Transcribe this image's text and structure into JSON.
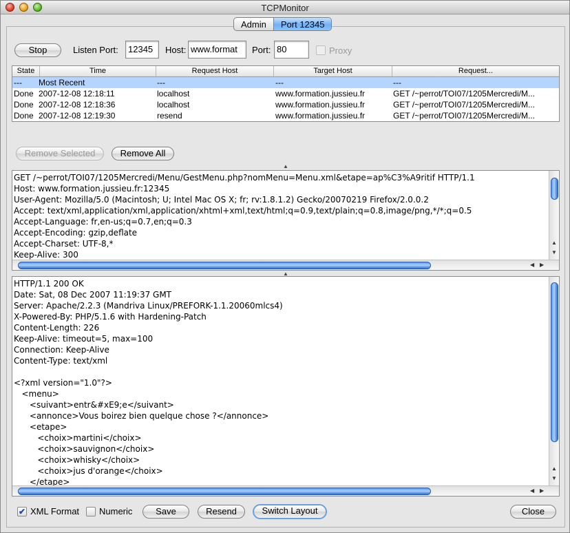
{
  "window": {
    "title": "TCPMonitor"
  },
  "tabs": [
    {
      "label": "Admin",
      "active": false
    },
    {
      "label": "Port 12345",
      "active": true
    }
  ],
  "toolbar": {
    "stop_label": "Stop",
    "listen_port_label": "Listen Port:",
    "listen_port_value": "12345",
    "host_label": "Host:",
    "host_value": "www.format",
    "port_label": "Port:",
    "port_value": "80",
    "proxy_label": "Proxy",
    "proxy_checked": false
  },
  "table": {
    "columns": [
      "State",
      "Time",
      "Request Host",
      "Target Host",
      "Request..."
    ],
    "rows": [
      {
        "state": "---",
        "time": "Most Recent",
        "request_host": "---",
        "target_host": "---",
        "request": "---",
        "selected": true
      },
      {
        "state": "Done",
        "time": "2007-12-08 12:18:11",
        "request_host": "localhost",
        "target_host": "www.formation.jussieu.fr",
        "request": "GET /~perrot/TOI07/1205Mercredi/M...",
        "selected": false
      },
      {
        "state": "Done",
        "time": "2007-12-08 12:18:36",
        "request_host": "localhost",
        "target_host": "www.formation.jussieu.fr",
        "request": "GET /~perrot/TOI07/1205Mercredi/M...",
        "selected": false
      },
      {
        "state": "Done",
        "time": "2007-12-08 12:19:30",
        "request_host": "resend",
        "target_host": "www.formation.jussieu.fr",
        "request": "GET /~perrot/TOI07/1205Mercredi/M...",
        "selected": false
      }
    ]
  },
  "actions": {
    "remove_selected_label": "Remove Selected",
    "remove_all_label": "Remove All"
  },
  "request_text": "GET /~perrot/TOI07/1205Mercredi/Menu/GestMenu.php?nomMenu=Menu.xml&etape=ap%C3%A9ritif HTTP/1.1\nHost: www.formation.jussieu.fr:12345\nUser-Agent: Mozilla/5.0 (Macintosh; U; Intel Mac OS X; fr; rv:1.8.1.2) Gecko/20070219 Firefox/2.0.0.2\nAccept: text/xml,application/xml,application/xhtml+xml,text/html;q=0.9,text/plain;q=0.8,image/png,*/*;q=0.5\nAccept-Language: fr,en-us;q=0.7,en;q=0.3\nAccept-Encoding: gzip,deflate\nAccept-Charset: UTF-8,*\nKeep-Alive: 300",
  "response_text": "HTTP/1.1 200 OK\nDate: Sat, 08 Dec 2007 11:19:37 GMT\nServer: Apache/2.2.3 (Mandriva Linux/PREFORK-1.1.20060mlcs4)\nX-Powered-By: PHP/5.1.6 with Hardening-Patch\nContent-Length: 226\nKeep-Alive: timeout=5, max=100\nConnection: Keep-Alive\nContent-Type: text/xml\n\n<?xml version=\"1.0\"?>\n   <menu>\n      <suivant>entr&#xE9;e</suivant>\n      <annonce>Vous boirez bien quelque chose ?</annonce>\n      <etape>\n         <choix>martini</choix>\n         <choix>sauvignon</choix>\n         <choix>whisky</choix>\n         <choix>jus d'orange</choix>\n      </etape>",
  "bottom": {
    "xml_format_label": "XML Format",
    "xml_format_checked": true,
    "numeric_label": "Numeric",
    "numeric_checked": false,
    "save_label": "Save",
    "resend_label": "Resend",
    "switch_layout_label": "Switch Layout",
    "close_label": "Close"
  },
  "icons": {
    "check_glyph": "✔",
    "scroll_up": "▲",
    "scroll_down": "▼",
    "scroll_left": "◀",
    "scroll_right": "▶",
    "splitter": "▲"
  }
}
